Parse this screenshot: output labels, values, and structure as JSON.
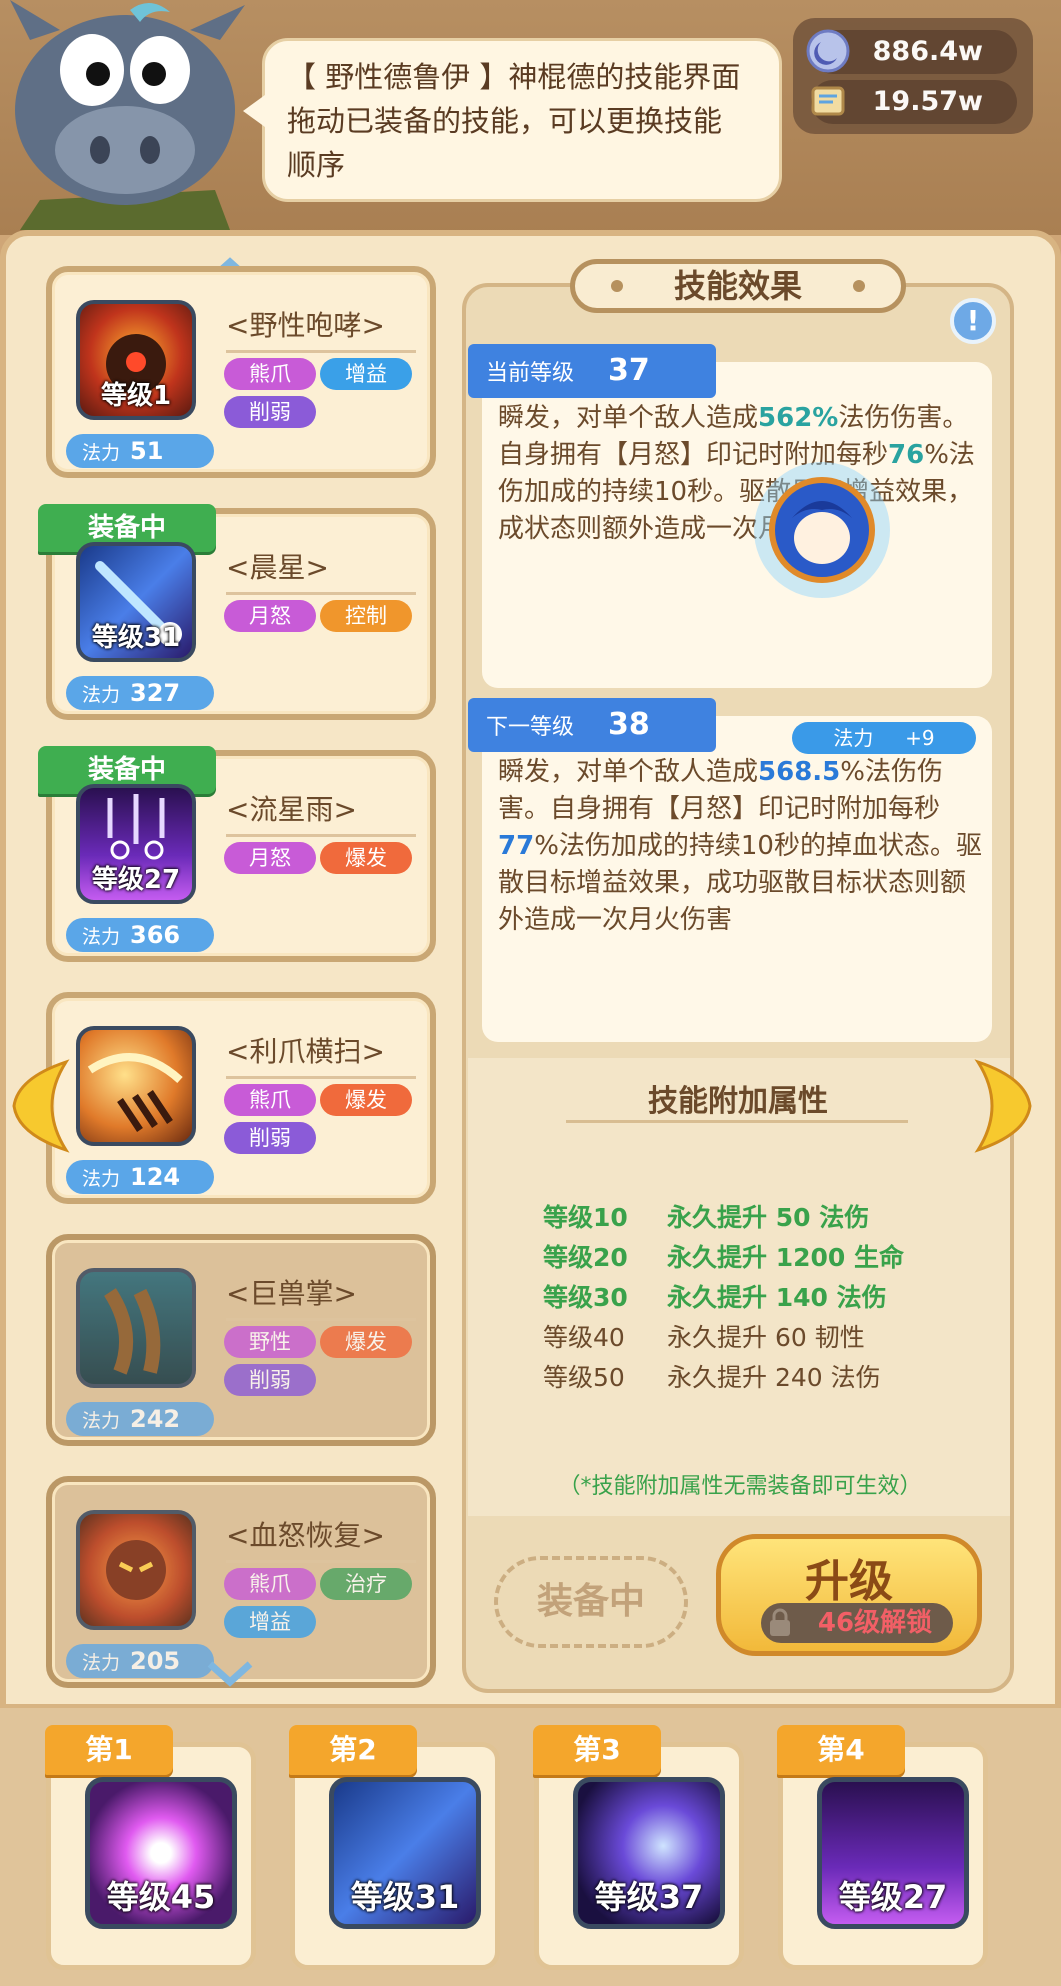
{
  "speech": {
    "line1": "【 野性德鲁伊 】神棍德的技能界面",
    "line2": "拖动已装备的技能，可以更换技能",
    "line3": "顺序"
  },
  "currency": [
    {
      "icon": "moon-coin-icon",
      "value": "886.4w"
    },
    {
      "icon": "scroll-icon",
      "value": "19.57w"
    }
  ],
  "skills": [
    {
      "name": "<野性咆哮>",
      "level": "等级1",
      "power_label": "法力",
      "power": "51",
      "tags": [
        "熊爪",
        "增益",
        "削弱"
      ],
      "equipped": false
    },
    {
      "name": "<晨星>",
      "level": "等级31",
      "power_label": "法力",
      "power": "327",
      "tags": [
        "月怒",
        "控制"
      ],
      "equipped": true,
      "equip_label": "装备中"
    },
    {
      "name": "<流星雨>",
      "level": "等级27",
      "power_label": "法力",
      "power": "366",
      "tags": [
        "月怒",
        "爆发"
      ],
      "equipped": true,
      "equip_label": "装备中"
    },
    {
      "name": "<利爪横扫>",
      "level": "",
      "power_label": "法力",
      "power": "124",
      "tags": [
        "熊爪",
        "爆发",
        "削弱"
      ],
      "equipped": false
    },
    {
      "name": "<巨兽掌>",
      "level": "",
      "power_label": "法力",
      "power": "242",
      "tags": [
        "野性",
        "爆发",
        "削弱"
      ],
      "equipped": false
    },
    {
      "name": "<血怒恢复>",
      "level": "",
      "power_label": "法力",
      "power": "205",
      "tags": [
        "熊爪",
        "治疗",
        "增益"
      ],
      "equipped": false
    }
  ],
  "effect": {
    "title": "技能效果",
    "current": {
      "label": "当前等级",
      "level": "37"
    },
    "current_desc": "瞬发，对单个敌人造成562%法伤伤害。自身拥有【月怒】印记时附加每秒76%法伤加成的持续10秒的掉血状态。驱散目标增益效果，成功驱散目标状态则额外造成一次月火伤害",
    "next": {
      "label": "下一等级",
      "level": "38"
    },
    "power_bonus": {
      "label": "法力",
      "value": "+9"
    },
    "next_desc_parts": [
      "瞬发，对单个敌人造成",
      "568.5",
      "%法伤伤害。自身拥有【月怒】印记时附加每秒",
      "77",
      "%法伤加成的持续10秒的掉血状态。驱散目标增益效果，成功驱散目标状态则额外造成一次月火伤害"
    ],
    "current_desc_parts": [
      "瞬发，对单个敌人造成",
      "562%",
      "法伤伤害。自身拥有【月怒】印记时附加每秒",
      "76",
      "%法伤加成的持续10秒",
      "驱散目标增益效果，成",
      "状态则额外造成一次月火伤"
    ]
  },
  "attrs": {
    "title": "技能附加属性",
    "rows": [
      {
        "level": "等级10",
        "effect": "永久提升 50 法伤",
        "active": true
      },
      {
        "level": "等级20",
        "effect": "永久提升 1200 生命",
        "active": true
      },
      {
        "level": "等级30",
        "effect": "永久提升 140 法伤",
        "active": true
      },
      {
        "level": "等级40",
        "effect": "永久提升 60 韧性",
        "active": false
      },
      {
        "level": "等级50",
        "effect": "永久提升 240 法伤",
        "active": false
      }
    ],
    "note": "（*技能附加属性无需装备即可生效）"
  },
  "buttons": {
    "equipped": "装备中",
    "upgrade": "升级",
    "unlock": "46级解锁"
  },
  "slots": [
    {
      "label": "第1",
      "level": "等级45"
    },
    {
      "label": "第2",
      "level": "等级31"
    },
    {
      "label": "第3",
      "level": "等级37"
    },
    {
      "label": "第4",
      "level": "等级27"
    }
  ],
  "colors": {
    "equip_green": "#3fae50",
    "highlight_teal": "#2aa3a0",
    "highlight_blue": "#2a7ad8",
    "ribbon_blue": "#3f82e0",
    "upgrade_gold": "#f2b93a"
  }
}
